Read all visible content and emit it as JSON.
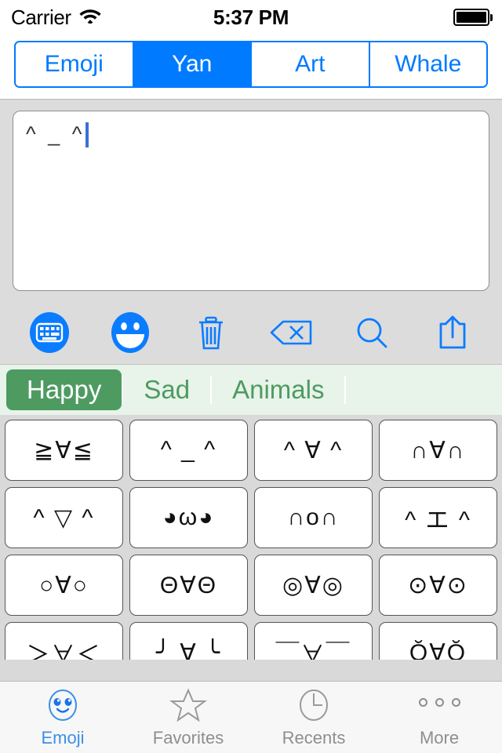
{
  "statusbar": {
    "carrier": "Carrier",
    "time": "5:37 PM",
    "wifi_icon": "wifi-icon",
    "battery_icon": "battery-full-icon"
  },
  "segmented_control": {
    "selected": "Yan",
    "items": [
      {
        "label": "Emoji",
        "active": false
      },
      {
        "label": "Yan",
        "active": true
      },
      {
        "label": "Art",
        "active": false
      },
      {
        "label": "Whale",
        "active": false
      }
    ]
  },
  "text_area": {
    "value": "^ _ ^",
    "placeholder": "",
    "caret_visible": true
  },
  "toolbar": {
    "buttons": [
      {
        "name": "keyboard-icon",
        "label": "Keyboard"
      },
      {
        "name": "smiley-icon",
        "label": "Emoji"
      },
      {
        "name": "trash-icon",
        "label": "Clear"
      },
      {
        "name": "backspace-icon",
        "label": "Delete"
      },
      {
        "name": "search-icon",
        "label": "Search"
      },
      {
        "name": "share-icon",
        "label": "Share"
      }
    ]
  },
  "categories": {
    "selected": "Happy",
    "items": [
      {
        "label": "Happy",
        "active": true
      },
      {
        "label": "Sad",
        "active": false
      },
      {
        "label": "Animals",
        "active": false
      }
    ]
  },
  "grid": {
    "rows": [
      [
        "≧∀≦",
        "^ _ ^",
        "^ ∀ ^",
        "∩∀∩"
      ],
      [
        "^ ▽ ^",
        "◕ω◕",
        "∩o∩",
        "^ エ ^"
      ],
      [
        "○∀○",
        "Θ∀Θ",
        "◎∀◎",
        "⊙∀⊙"
      ],
      [
        "＞∀＜",
        "╯ ∀ ╰",
        "￣∀￣",
        "Ŏ∀Ŏ"
      ]
    ]
  },
  "tabbar": {
    "selected": "Emoji",
    "items": [
      {
        "label": "Emoji",
        "icon": "emoji-face-icon",
        "active": true
      },
      {
        "label": "Favorites",
        "icon": "star-icon",
        "active": false
      },
      {
        "label": "Recents",
        "icon": "clock-icon",
        "active": false
      },
      {
        "label": "More",
        "icon": "ellipsis-icon",
        "active": false
      }
    ]
  },
  "colors": {
    "accent_blue": "#007AFF",
    "tab_blue": "#3b8fe8",
    "category_green": "#4e9b62",
    "category_bg": "#e8f3e9",
    "chrome_gray": "#d9d9d9"
  }
}
